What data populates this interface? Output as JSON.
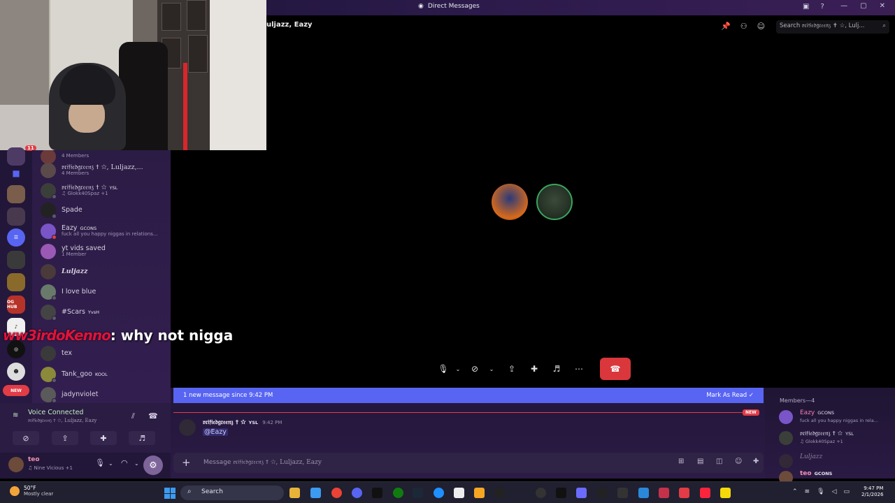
{
  "window": {
    "title": "Direct Messages",
    "buttons": [
      "—",
      "▢",
      "✕"
    ]
  },
  "call": {
    "header": "uljazz, Eazy",
    "search_placeholder": "Search 𝔳𝔯𝔦𝔣𝔦𝔢𝔡𝔤𝔯𝔢𝔢𝔫𝔷 ✝ ☆, Lulj...",
    "overlay_author": "ww3irdoKenno",
    "overlay_message": ": why not nigga"
  },
  "servers": {
    "badge_count": "11",
    "items": [
      "OG HUB",
      "NEW"
    ]
  },
  "dm_list": [
    {
      "name": "",
      "sub": "4 Members"
    },
    {
      "name": "𝔳𝔯𝔦𝔣𝔦𝔢𝔡𝔤𝔯𝔢𝔢𝔫𝔷 ✝ ☆, Luljazz,...",
      "sub": "4 Members",
      "tag": ""
    },
    {
      "name": "𝔳𝔯𝔦𝔣𝔦𝔢𝔡𝔤𝔯𝔢𝔢𝔫𝔷 ✝ ☆",
      "sub": "♫ Glokk40Spaz +1",
      "tag": "YSL"
    },
    {
      "name": "Spade",
      "sub": "",
      "tag": ""
    },
    {
      "name": "Eazy",
      "sub": "fuck all you happy niggas in relations...",
      "tag": "GCONS"
    },
    {
      "name": "yt vids saved",
      "sub": "1 Member",
      "tag": ""
    },
    {
      "name": "Luljazz",
      "sub": "",
      "tag": ""
    },
    {
      "name": "I love blue",
      "sub": "",
      "tag": ""
    },
    {
      "name": "#Scars",
      "sub": "",
      "tag": "YvsH"
    },
    {
      "name": "tex",
      "sub": "",
      "tag": ""
    },
    {
      "name": "Tank_goo",
      "sub": "",
      "tag": "KOOL"
    },
    {
      "name": "jadynviolet",
      "sub": "",
      "tag": ""
    }
  ],
  "voice": {
    "status": "Voice Connected",
    "channel": "𝔳𝔯𝔦𝔣𝔦𝔢𝔡𝔤𝔯𝔢𝔢𝔫𝔷 ✝ ☆, Luljazz, Eazy"
  },
  "user": {
    "name": "teo",
    "status": "♫ Nine Vicious +1"
  },
  "chat": {
    "new_banner": "1 new message since 9:42 PM",
    "mark_read": "Mark As Read",
    "new_pill": "NEW",
    "author": "𝔳𝔯𝔦𝔣𝔦𝔢𝔡𝔤𝔯𝔢𝔢𝔫𝔷 ✝ ☆",
    "author_tag": "YSL",
    "time": "9:42 PM",
    "mention": "@Eazy",
    "input_prefix": "Message ",
    "input_target": "𝔳𝔯𝔦𝔣𝔦𝔢𝔡𝔤𝔯𝔢𝔢𝔫𝔷 ✝ ☆, Luljazz, Eazy"
  },
  "members": {
    "header": "Members—4",
    "list": [
      {
        "name": "Eazy",
        "sub": "fuck all you happy niggas in rela...",
        "tag": "GCONS",
        "color": "#f47fb1"
      },
      {
        "name": "𝔳𝔯𝔦𝔣𝔦𝔢𝔡𝔤𝔯𝔢𝔢𝔫𝔷 ✝ ☆",
        "sub": "♫ Glokk40Spaz +1",
        "tag": "YSL",
        "color": "#e4e0ee"
      },
      {
        "name": "Luljazz",
        "sub": "",
        "tag": "",
        "color": "#8b819c"
      },
      {
        "name": "teo",
        "sub": "",
        "tag": "GCONS",
        "color": "#f092b6"
      }
    ]
  },
  "taskbar": {
    "weather_temp": "50°F",
    "weather_desc": "Mostly clear",
    "search": "Search",
    "time": "9:47 PM",
    "date": "2/1/2026"
  },
  "colors": {
    "accent": "#5865f2",
    "danger": "#da373c",
    "sidebar": "#2b1c45"
  }
}
